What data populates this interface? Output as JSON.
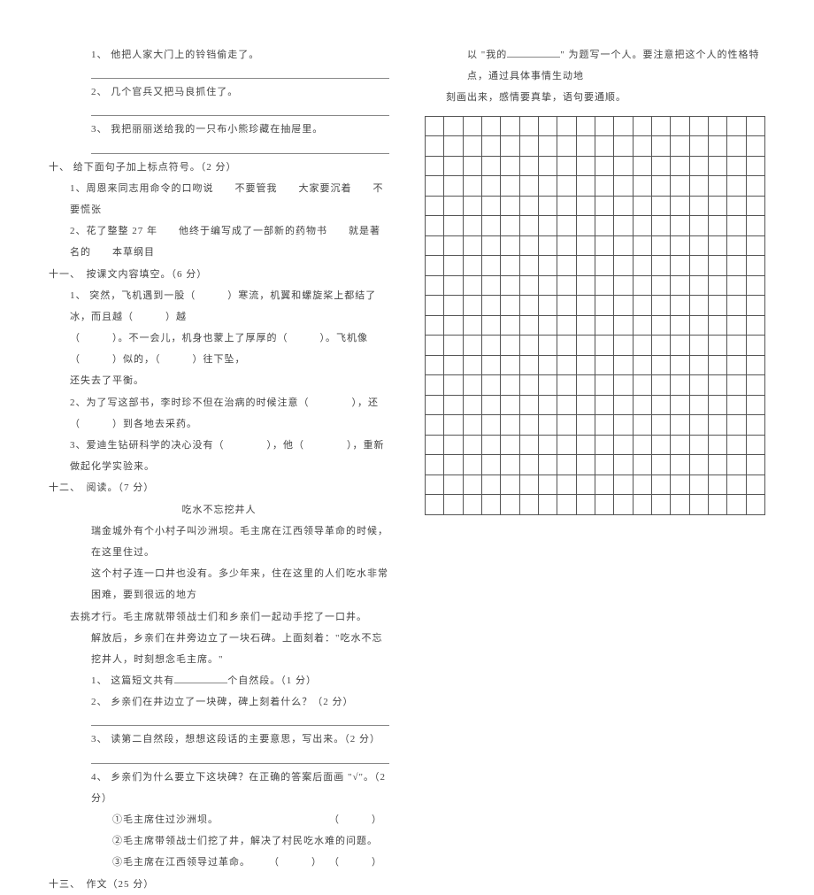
{
  "left": {
    "q1": "1、 他把人家大门上的铃铛偷走了。",
    "q2": "2、 几个官兵又把马良抓住了。",
    "q3": "3、 我把丽丽送给我的一只布小熊珍藏在抽屉里。",
    "sec10": "十、 给下面句子加上标点符号。（2 分）",
    "s10_1": "1、周恩来同志用命令的口吻说　　不要管我　　大家要沉着　　不要慌张",
    "s10_2": "2、花了整整 27 年　　他终于编写成了一部新的药物书　　就是著名的　　本草纲目",
    "sec11": "十一、　按课文内容填空。（6 分）",
    "s11_1a": "1、 突然，飞机遇到一股（　　　）寒流，机翼和螺旋桨上都结了冰，而且越（　　　）越",
    "s11_1b": "（　　　）。不一会儿，机身也蒙上了厚厚的（　　　）。飞机像（　　　）似的，（　　　）往下坠，",
    "s11_1c": "还失去了平衡。",
    "s11_2": "2、为了写这部书，李时珍不但在治病的时候注意（　　　　），还（　　　）到各地去采药。",
    "s11_3": "3、爱迪生钻研科学的决心没有（　　　　），他（　　　　），重新做起化学实验来。",
    "sec12": "十二、　阅读。（7 分）",
    "title": "吃水不忘挖井人",
    "p1": "瑞金城外有个小村子叫沙洲坝。毛主席在江西领导革命的时候，在这里住过。",
    "p2a": "这个村子连一口井也没有。多少年来，住在这里的人们吃水非常困难，要到很远的地方",
    "p2b": "去挑才行。毛主席就带领战士们和乡亲们一起动手挖了一口井。",
    "p3": "解放后，乡亲们在井旁边立了一块石碑。上面刻着：\"吃水不忘挖井人，时刻想念毛主席。\"",
    "q12_1a": "1、 这篇短文共有",
    "q12_1b": "个自然段。（1 分）",
    "q12_2": "2、 乡亲们在井边立了一块碑，碑上刻着什么？（2 分）",
    "q12_3": "3、 读第二自然段，想想这段话的主要意思，写出来。（2 分）",
    "q12_4": "4、 乡亲们为什么要立下这块碑？在正确的答案后面画 \"√\"。（2 分）",
    "opt1": "①毛主席住过沙洲坝。",
    "opt2": "②毛主席带领战士们挖了井，解决了村民吃水难的问题。",
    "opt3": "③毛主席在江西领导过革命。",
    "sec13": "十三、　作文（25 分）",
    "paren": "（　　　）"
  },
  "right": {
    "intro_a": "以 \"我的",
    "intro_b": "\" 为题写一个人。要注意把这个人的性格特点，通过具体事情生动地",
    "intro_c": "刻画出来，感情要真挚，语句要通顺。"
  }
}
